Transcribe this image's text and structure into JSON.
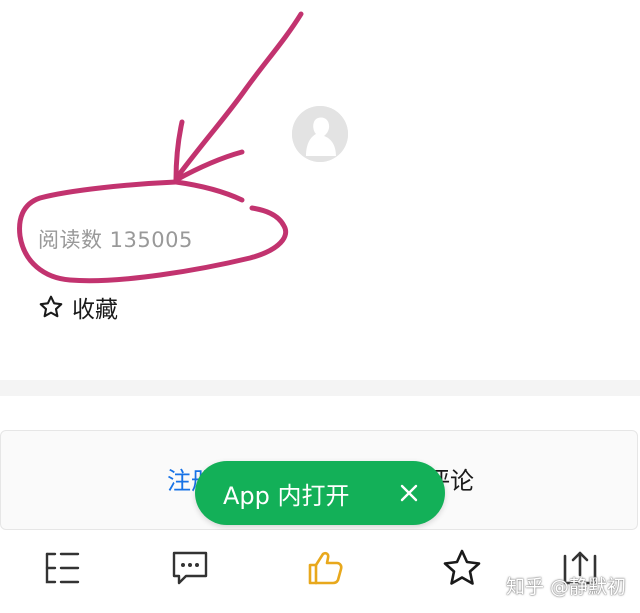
{
  "stats": {
    "read_count": "阅读数 135005"
  },
  "actions": {
    "favorite_label": "收藏"
  },
  "comment_bar": {
    "left_text": "注册",
    "right_text": "评论"
  },
  "open_app_banner": {
    "label": "App 内打开"
  },
  "watermark": {
    "text": "知乎 @静默初"
  },
  "colors": {
    "annotation_ink": "#c2336f",
    "app_banner_green": "#13b058",
    "like_icon_gold": "#e8a81c",
    "link_blue": "#1772e6",
    "muted_text": "#999999"
  },
  "icons": {
    "avatar": "default-avatar-icon",
    "favorite": "star-outline-icon",
    "close": "close-icon",
    "catalog": "catalog-list-icon",
    "comment": "comment-bubble-icon",
    "like": "thumbs-up-icon",
    "collect": "star-outline-icon",
    "share": "share-icon"
  }
}
